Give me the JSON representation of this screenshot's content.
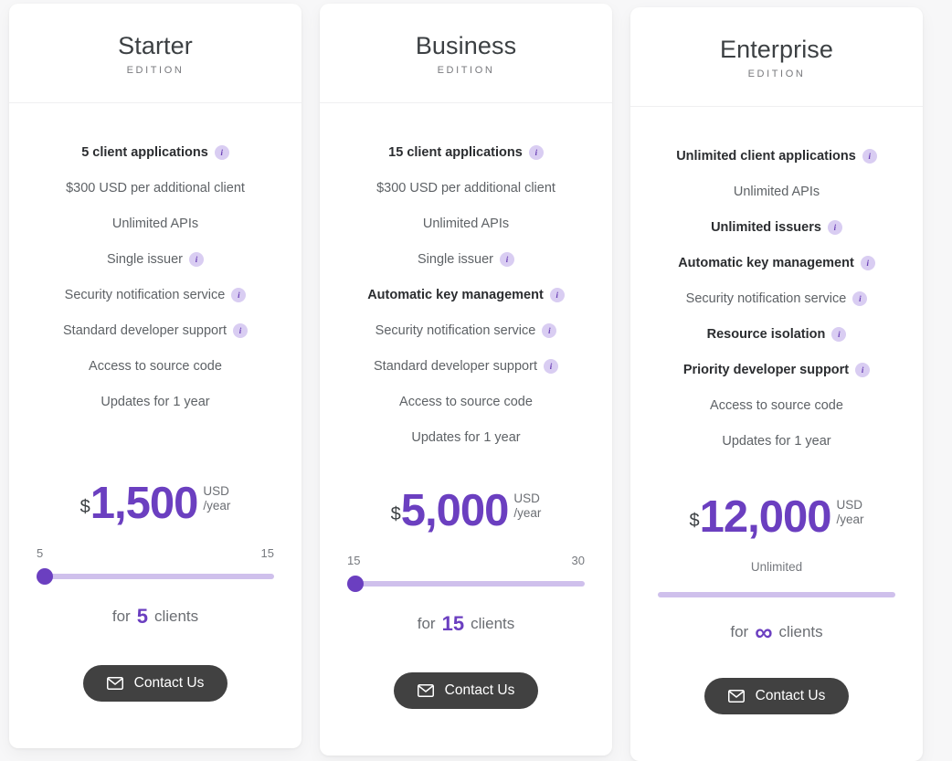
{
  "plans": [
    {
      "name": "Starter",
      "edition": "EDITION",
      "features": [
        {
          "text": "5 client applications",
          "bold": true,
          "info": true
        },
        {
          "text": "$300 USD per additional client",
          "bold": false,
          "info": false
        },
        {
          "text": "Unlimited APIs",
          "bold": false,
          "info": false
        },
        {
          "text": "Single issuer",
          "bold": false,
          "info": true
        },
        {
          "text": "Security notification service",
          "bold": false,
          "info": true
        },
        {
          "text": "Standard developer support",
          "bold": false,
          "info": true
        },
        {
          "text": "Access to source code",
          "bold": false,
          "info": false
        },
        {
          "text": "Updates for 1 year",
          "bold": false,
          "info": false
        }
      ],
      "price": {
        "currency": "$",
        "amount": "1,500",
        "unit_currency": "USD",
        "unit_period": "/year"
      },
      "slider": {
        "min_label": "5",
        "max_label": "15",
        "center_label": "",
        "value_percent": 0,
        "has_thumb": true
      },
      "clients": {
        "prefix": "for",
        "value": "5",
        "suffix": "clients",
        "infinity": false
      },
      "cta": {
        "label": "Contact Us",
        "icon": "envelope-icon"
      }
    },
    {
      "name": "Business",
      "edition": "EDITION",
      "features": [
        {
          "text": "15 client applications",
          "bold": true,
          "info": true
        },
        {
          "text": "$300 USD per additional client",
          "bold": false,
          "info": false
        },
        {
          "text": "Unlimited APIs",
          "bold": false,
          "info": false
        },
        {
          "text": "Single issuer",
          "bold": false,
          "info": true
        },
        {
          "text": "Automatic key management",
          "bold": true,
          "info": true
        },
        {
          "text": "Security notification service",
          "bold": false,
          "info": true
        },
        {
          "text": "Standard developer support",
          "bold": false,
          "info": true
        },
        {
          "text": "Access to source code",
          "bold": false,
          "info": false
        },
        {
          "text": "Updates for 1 year",
          "bold": false,
          "info": false
        }
      ],
      "price": {
        "currency": "$",
        "amount": "5,000",
        "unit_currency": "USD",
        "unit_period": "/year"
      },
      "slider": {
        "min_label": "15",
        "max_label": "30",
        "center_label": "",
        "value_percent": 0,
        "has_thumb": true
      },
      "clients": {
        "prefix": "for",
        "value": "15",
        "suffix": "clients",
        "infinity": false
      },
      "cta": {
        "label": "Contact Us",
        "icon": "envelope-icon"
      }
    },
    {
      "name": "Enterprise",
      "edition": "EDITION",
      "features": [
        {
          "text": "Unlimited client applications",
          "bold": true,
          "info": true
        },
        {
          "text": "Unlimited APIs",
          "bold": false,
          "info": false
        },
        {
          "text": "Unlimited issuers",
          "bold": true,
          "info": true
        },
        {
          "text": "Automatic key management",
          "bold": true,
          "info": true
        },
        {
          "text": "Security notification service",
          "bold": false,
          "info": true
        },
        {
          "text": "Resource isolation",
          "bold": true,
          "info": true
        },
        {
          "text": "Priority developer support",
          "bold": true,
          "info": true
        },
        {
          "text": "Access to source code",
          "bold": false,
          "info": false
        },
        {
          "text": "Updates for 1 year",
          "bold": false,
          "info": false
        }
      ],
      "price": {
        "currency": "$",
        "amount": "12,000",
        "unit_currency": "USD",
        "unit_period": "/year"
      },
      "slider": {
        "min_label": "",
        "max_label": "",
        "center_label": "Unlimited",
        "value_percent": 0,
        "has_thumb": false
      },
      "clients": {
        "prefix": "for",
        "value": "∞",
        "suffix": "clients",
        "infinity": true
      },
      "cta": {
        "label": "Contact Us",
        "icon": "envelope-icon"
      }
    }
  ],
  "colors": {
    "accent": "#6b3fc0",
    "accent_light": "#cfc0ec",
    "info_badge_bg": "#d9cdf2",
    "button_bg": "#414141",
    "page_bg": "#f7f7f8",
    "card_bg": "#ffffff",
    "text_muted": "#5e6266",
    "text_strong": "#2b2d30"
  },
  "info_icon_glyph": "i"
}
